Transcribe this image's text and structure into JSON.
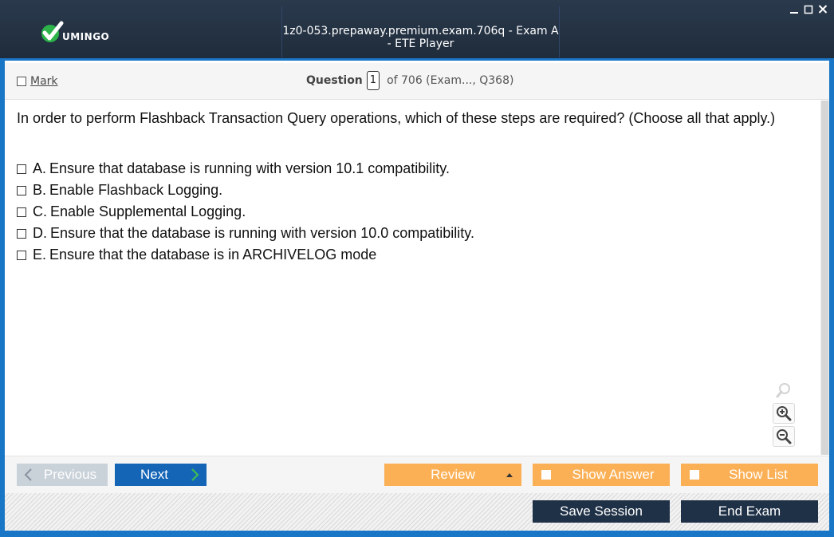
{
  "window": {
    "title": "1z0-053.prepaway.premium.exam.706q - Exam A - ETE Player",
    "logo_text": "UMINGO",
    "controls": [
      "minimize",
      "maximize",
      "close"
    ]
  },
  "toolbar": {
    "mark_label": "Mark",
    "question_label": "Question",
    "question_number": "1",
    "question_total_text": "of 706 (Exam..., Q368)"
  },
  "question": {
    "text": "In order to perform Flashback Transaction Query operations, which of these steps are required? (Choose all that apply.)",
    "answers": [
      {
        "letter": "A.",
        "text": "Ensure that database is running with version 10.1 compatibility."
      },
      {
        "letter": "B.",
        "text": "Enable Flashback Logging."
      },
      {
        "letter": "C.",
        "text": "Enable Supplemental Logging."
      },
      {
        "letter": "D.",
        "text": "Ensure that the database is running with version 10.0 compatibility."
      },
      {
        "letter": "E.",
        "text": "Ensure that the database is in ARCHIVELOG mode"
      }
    ]
  },
  "nav": {
    "previous_label": "Previous",
    "next_label": "Next",
    "review_label": "Review",
    "show_answer_label": "Show Answer",
    "show_list_label": "Show List"
  },
  "footer": {
    "save_label": "Save Session",
    "end_label": "End Exam"
  },
  "icons": {
    "logo": "checkmark-logo-icon",
    "zoom_reset": "magnifier-icon",
    "zoom_in": "zoom-in-icon",
    "zoom_out": "zoom-out-icon",
    "previous": "chevron-left-icon",
    "next": "chevron-right-icon",
    "review": "triangle-up-icon"
  },
  "colors": {
    "titlebar": "#1f2c3b",
    "accent_blue": "#1976c7",
    "next_button": "#1565b7",
    "orange_button": "#fbb056",
    "dark_button": "#1f3147",
    "disabled_button": "#c9d1d9"
  }
}
